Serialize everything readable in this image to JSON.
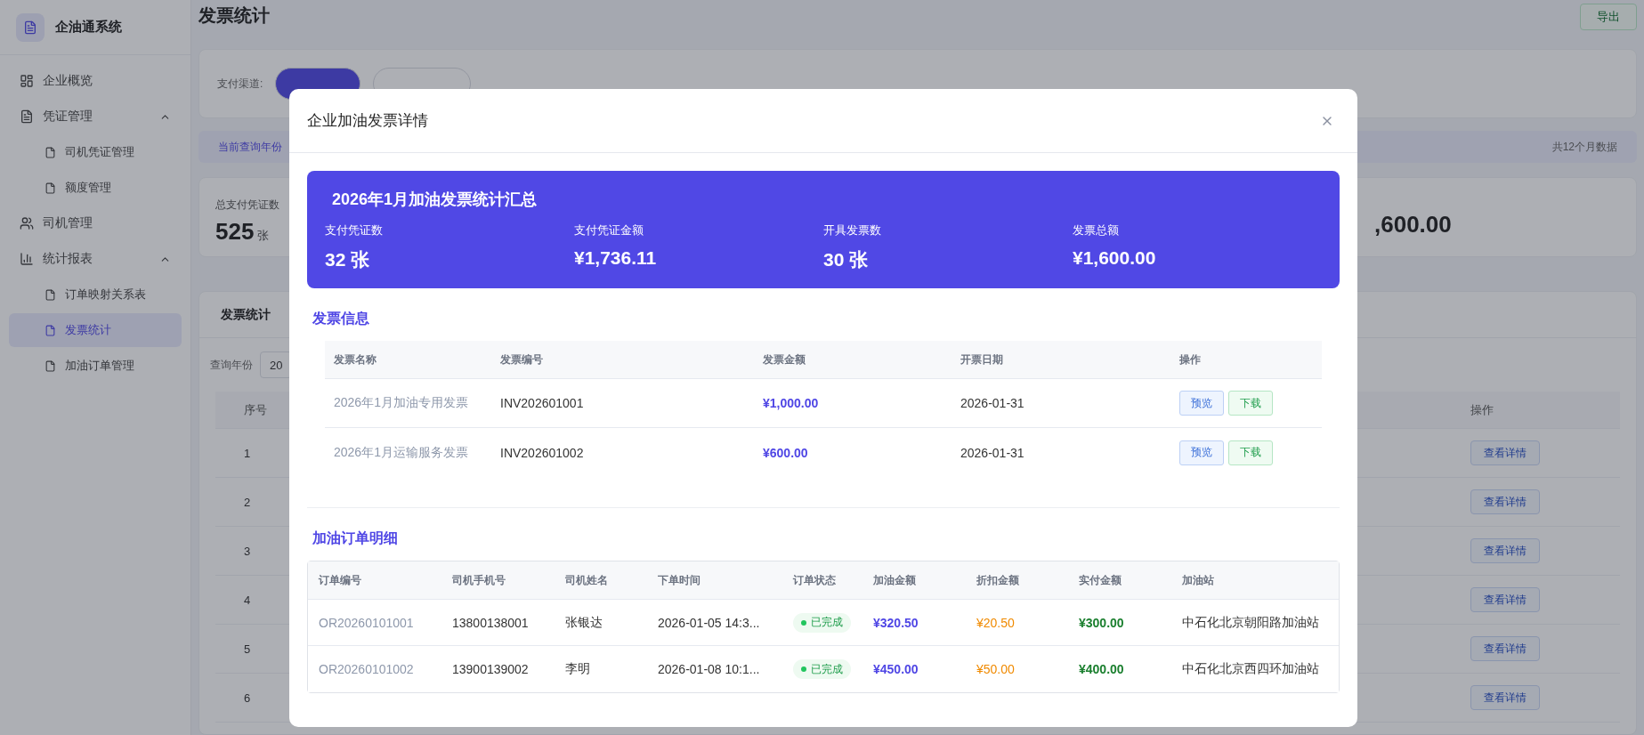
{
  "sidebar": {
    "app_name": "企油通系统",
    "items": [
      {
        "label": "企业概览",
        "selected": false
      },
      {
        "label": "凭证管理",
        "selected": false,
        "expanded": true,
        "children": [
          {
            "label": "司机凭证管理",
            "selected": false
          },
          {
            "label": "额度管理",
            "selected": false
          }
        ]
      },
      {
        "label": "司机管理",
        "selected": false
      },
      {
        "label": "统计报表",
        "selected": false,
        "expanded": true,
        "children": [
          {
            "label": "订单映射关系表",
            "selected": false
          },
          {
            "label": "发票统计",
            "selected": true
          },
          {
            "label": "加油订单管理",
            "selected": false
          }
        ]
      }
    ]
  },
  "page": {
    "title": "发票统计",
    "export_button": "导出",
    "filter_label": "支付渠道:",
    "info_text": "当前查询年份",
    "info_count": "共12个月数据",
    "stat_left": {
      "label": "总支付凭证数",
      "value": "525",
      "unit": "张"
    },
    "stat_right": {
      "value": ",600.00"
    },
    "tab": "发票统计",
    "year_label": "查询年份",
    "year_value": "20",
    "table": {
      "first_column": "序号",
      "last_column": "操作",
      "rows": [
        {
          "index": "1",
          "action": "查看详情"
        },
        {
          "index": "2",
          "action": "查看详情"
        },
        {
          "index": "3",
          "action": "查看详情"
        },
        {
          "index": "4",
          "action": "查看详情"
        },
        {
          "index": "5",
          "action": "查看详情"
        },
        {
          "index": "6",
          "action": "查看详情"
        }
      ]
    }
  },
  "modal": {
    "title": "企业加油发票详情",
    "summary": {
      "title": "2026年1月加油发票统计汇总",
      "stats": [
        {
          "label": "支付凭证数",
          "value": "32 张"
        },
        {
          "label": "支付凭证金额",
          "value": "¥1,736.11"
        },
        {
          "label": "开具发票数",
          "value": "30 张"
        },
        {
          "label": "发票总额",
          "value": "¥1,600.00"
        }
      ]
    },
    "invoices": {
      "title": "发票信息",
      "columns": [
        "发票名称",
        "发票编号",
        "发票金额",
        "开票日期",
        "操作"
      ],
      "rows": [
        {
          "name": "2026年1月加油专用发票",
          "number": "INV202601001",
          "amount": "¥1,000.00",
          "date": "2026-01-31",
          "actions": [
            "预览",
            "下载"
          ]
        },
        {
          "name": "2026年1月运输服务发票",
          "number": "INV202601002",
          "amount": "¥600.00",
          "date": "2026-01-31",
          "actions": [
            "预览",
            "下载"
          ]
        }
      ]
    },
    "orders": {
      "title": "加油订单明细",
      "columns": [
        "订单编号",
        "司机手机号",
        "司机姓名",
        "下单时间",
        "订单状态",
        "加油金额",
        "折扣金额",
        "实付金额",
        "加油站"
      ],
      "rows": [
        {
          "order_no": "OR20260101001",
          "phone": "13800138001",
          "driver": "张银达",
          "time": "2026-01-05 14:3...",
          "status": "已完成",
          "fuel_amount": "¥320.50",
          "discount": "¥20.50",
          "paid": "¥300.00",
          "station": "中石化北京朝阳路加油站"
        },
        {
          "order_no": "OR20260101002",
          "phone": "13900139002",
          "driver": "李明",
          "time": "2026-01-08 10:1...",
          "status": "已完成",
          "fuel_amount": "¥450.00",
          "discount": "¥50.00",
          "paid": "¥400.00",
          "station": "中石化北京西四环加油站"
        }
      ]
    }
  }
}
